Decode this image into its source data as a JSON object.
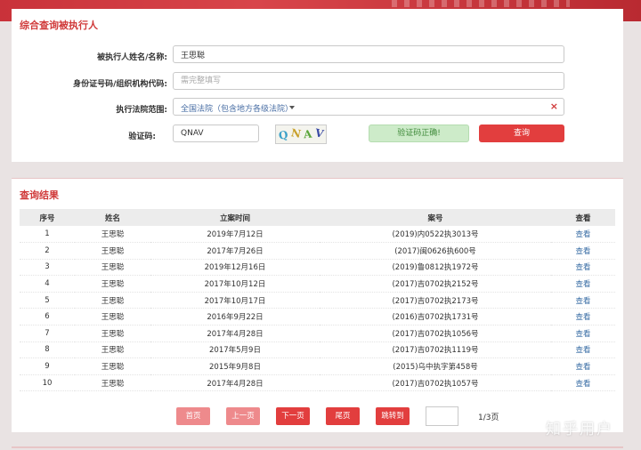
{
  "search": {
    "title": "综合查询被执行人",
    "name_label": "被执行人姓名/名称:",
    "name_value": "王思聪",
    "id_label": "身份证号码/组织机构代码:",
    "id_placeholder": "需完整填写",
    "court_label": "执行法院范围:",
    "court_value": "全国法院（包含地方各级法院）",
    "captcha_label": "验证码:",
    "captcha_value": "QNAV",
    "captcha_image_text": "QNAV",
    "verify_status": "验证码正确!",
    "query_button": "查询"
  },
  "results": {
    "title": "查询结果",
    "columns": [
      "序号",
      "姓名",
      "立案时间",
      "案号",
      "查看"
    ],
    "rows": [
      [
        "1",
        "王思聪",
        "2019年7月12日",
        "(2019)内0522执3013号",
        "查看"
      ],
      [
        "2",
        "王思聪",
        "2017年7月26日",
        "(2017)闽0626执600号",
        "查看"
      ],
      [
        "3",
        "王思聪",
        "2019年12月16日",
        "(2019)鲁0812执1972号",
        "查看"
      ],
      [
        "4",
        "王思聪",
        "2017年10月12日",
        "(2017)吉0702执2152号",
        "查看"
      ],
      [
        "5",
        "王思聪",
        "2017年10月17日",
        "(2017)吉0702执2173号",
        "查看"
      ],
      [
        "6",
        "王思聪",
        "2016年9月22日",
        "(2016)吉0702执1731号",
        "查看"
      ],
      [
        "7",
        "王思聪",
        "2017年4月28日",
        "(2017)吉0702执1056号",
        "查看"
      ],
      [
        "8",
        "王思聪",
        "2017年5月9日",
        "(2017)吉0702执1119号",
        "查看"
      ],
      [
        "9",
        "王思聪",
        "2015年9月8日",
        "(2015)乌中执字第458号",
        "查看"
      ],
      [
        "10",
        "王思聪",
        "2017年4月28日",
        "(2017)吉0702执1057号",
        "查看"
      ]
    ]
  },
  "pager": {
    "first": "首页",
    "prev": "上一页",
    "next": "下一页",
    "last": "尾页",
    "jump": "跳转到",
    "page_info": "1/3页"
  },
  "watermark": "知乎用户",
  "colors": {
    "accent": "#e23e3e",
    "title": "#d03a3a",
    "link": "#3a6ea5",
    "success_bg": "#cdebc9"
  }
}
